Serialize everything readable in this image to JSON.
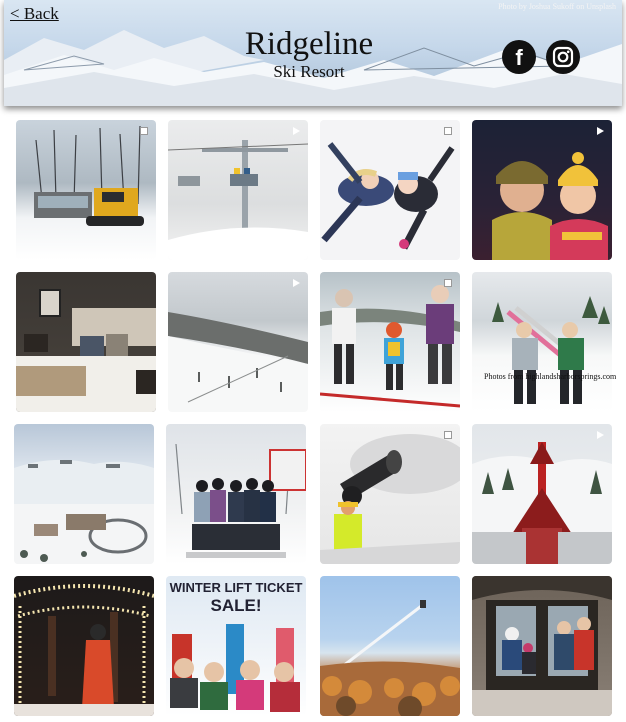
{
  "header": {
    "back_label": "< Back",
    "photo_credit": "Photo by Joshua Sukoff on Unsplash",
    "title": "Ridgeline",
    "subtitle": "Ski Resort"
  },
  "social": {
    "facebook_icon": "facebook-icon",
    "instagram_icon": "instagram-icon"
  },
  "gallery": {
    "photos_credit": "Photos from highlandsharborsprings.com",
    "promo": {
      "line1": "WINTER LIFT TICKET",
      "line2": "SALE!"
    }
  },
  "colors": {
    "header_sky": "#c5d7ea",
    "social_bg": "#111111",
    "page_bg": "#ffffff"
  }
}
